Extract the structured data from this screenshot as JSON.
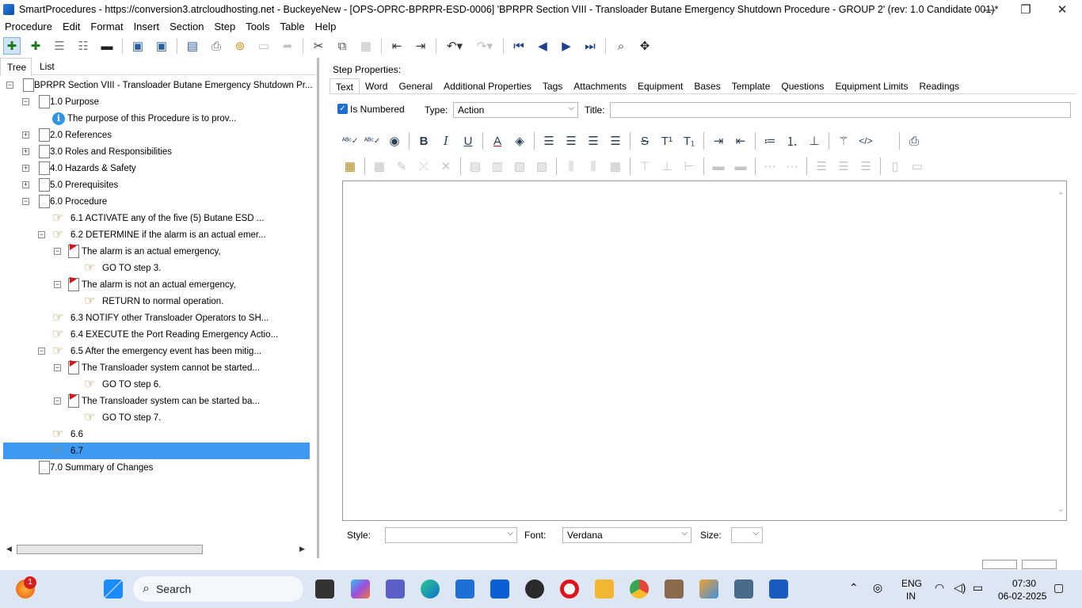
{
  "window": {
    "title": "SmartProcedures - https://conversion3.atrcloudhosting.net - BuckeyeNew - [OPS-OPRC-BPRPR-ESD-0006] 'BPRPR Section VIII - Transloader Butane Emergency Shutdown Procedure - GROUP 2' (rev: 1.0 Candidate 001)*",
    "minimize": "—",
    "restore": "❐",
    "close": "✕"
  },
  "menu": [
    "Procedure",
    "Edit",
    "Format",
    "Insert",
    "Section",
    "Step",
    "Tools",
    "Table",
    "Help"
  ],
  "left_tabs": {
    "tree": "Tree",
    "list": "List"
  },
  "tree": [
    {
      "label": "BPRPR Section VIII - Transloader Butane Emergency Shutdown Pr..."
    },
    {
      "label": "1.0 Purpose"
    },
    {
      "label": "The purpose of this Procedure is to prov..."
    },
    {
      "label": "2.0 References"
    },
    {
      "label": "3.0 Roles and Responsibilities"
    },
    {
      "label": "4.0 Hazards & Safety"
    },
    {
      "label": "5.0 Prerequisites"
    },
    {
      "label": "6.0 Procedure"
    },
    {
      "label": "6.1 ACTIVATE any of the five (5) Butane ESD ..."
    },
    {
      "label": "6.2 DETERMINE if the alarm is an actual emer..."
    },
    {
      "label": "The alarm is an actual emergency,"
    },
    {
      "label": "GO TO step 3."
    },
    {
      "label": "The alarm is not an actual emergency,"
    },
    {
      "label": "RETURN to normal operation."
    },
    {
      "label": "6.3 NOTIFY other Transloader Operators to SH..."
    },
    {
      "label": "6.4 EXECUTE the Port Reading Emergency Actio..."
    },
    {
      "label": "6.5 After the emergency event has been mitig..."
    },
    {
      "label": "The Transloader system cannot be started..."
    },
    {
      "label": "GO TO step 6."
    },
    {
      "label": "The Transloader system can be started ba..."
    },
    {
      "label": "GO TO step 7."
    },
    {
      "label": "6.6"
    },
    {
      "label": "6.7"
    },
    {
      "label": "7.0 Summary of Changes"
    }
  ],
  "right": {
    "header": "Step Properties:",
    "tabs": [
      "Text",
      "Word",
      "General",
      "Additional Properties",
      "Tags",
      "Attachments",
      "Equipment",
      "Bases",
      "Template",
      "Questions",
      "Equipment Limits",
      "Readings"
    ],
    "is_numbered_label": "Is Numbered",
    "type_label": "Type:",
    "type_value": "Action",
    "title_label": "Title:",
    "title_value": "",
    "style_label": "Style:",
    "style_value": "",
    "font_label": "Font:",
    "font_value": "Verdana",
    "size_label": "Size:",
    "size_value": ""
  },
  "taskbar": {
    "search": "Search",
    "lang": "ENG",
    "region": "IN",
    "time": "07:30",
    "date": "06-02-2025",
    "notification_count": "1"
  },
  "colors": {
    "selection": "#3d9af0",
    "accent": "#1f6fd1"
  }
}
